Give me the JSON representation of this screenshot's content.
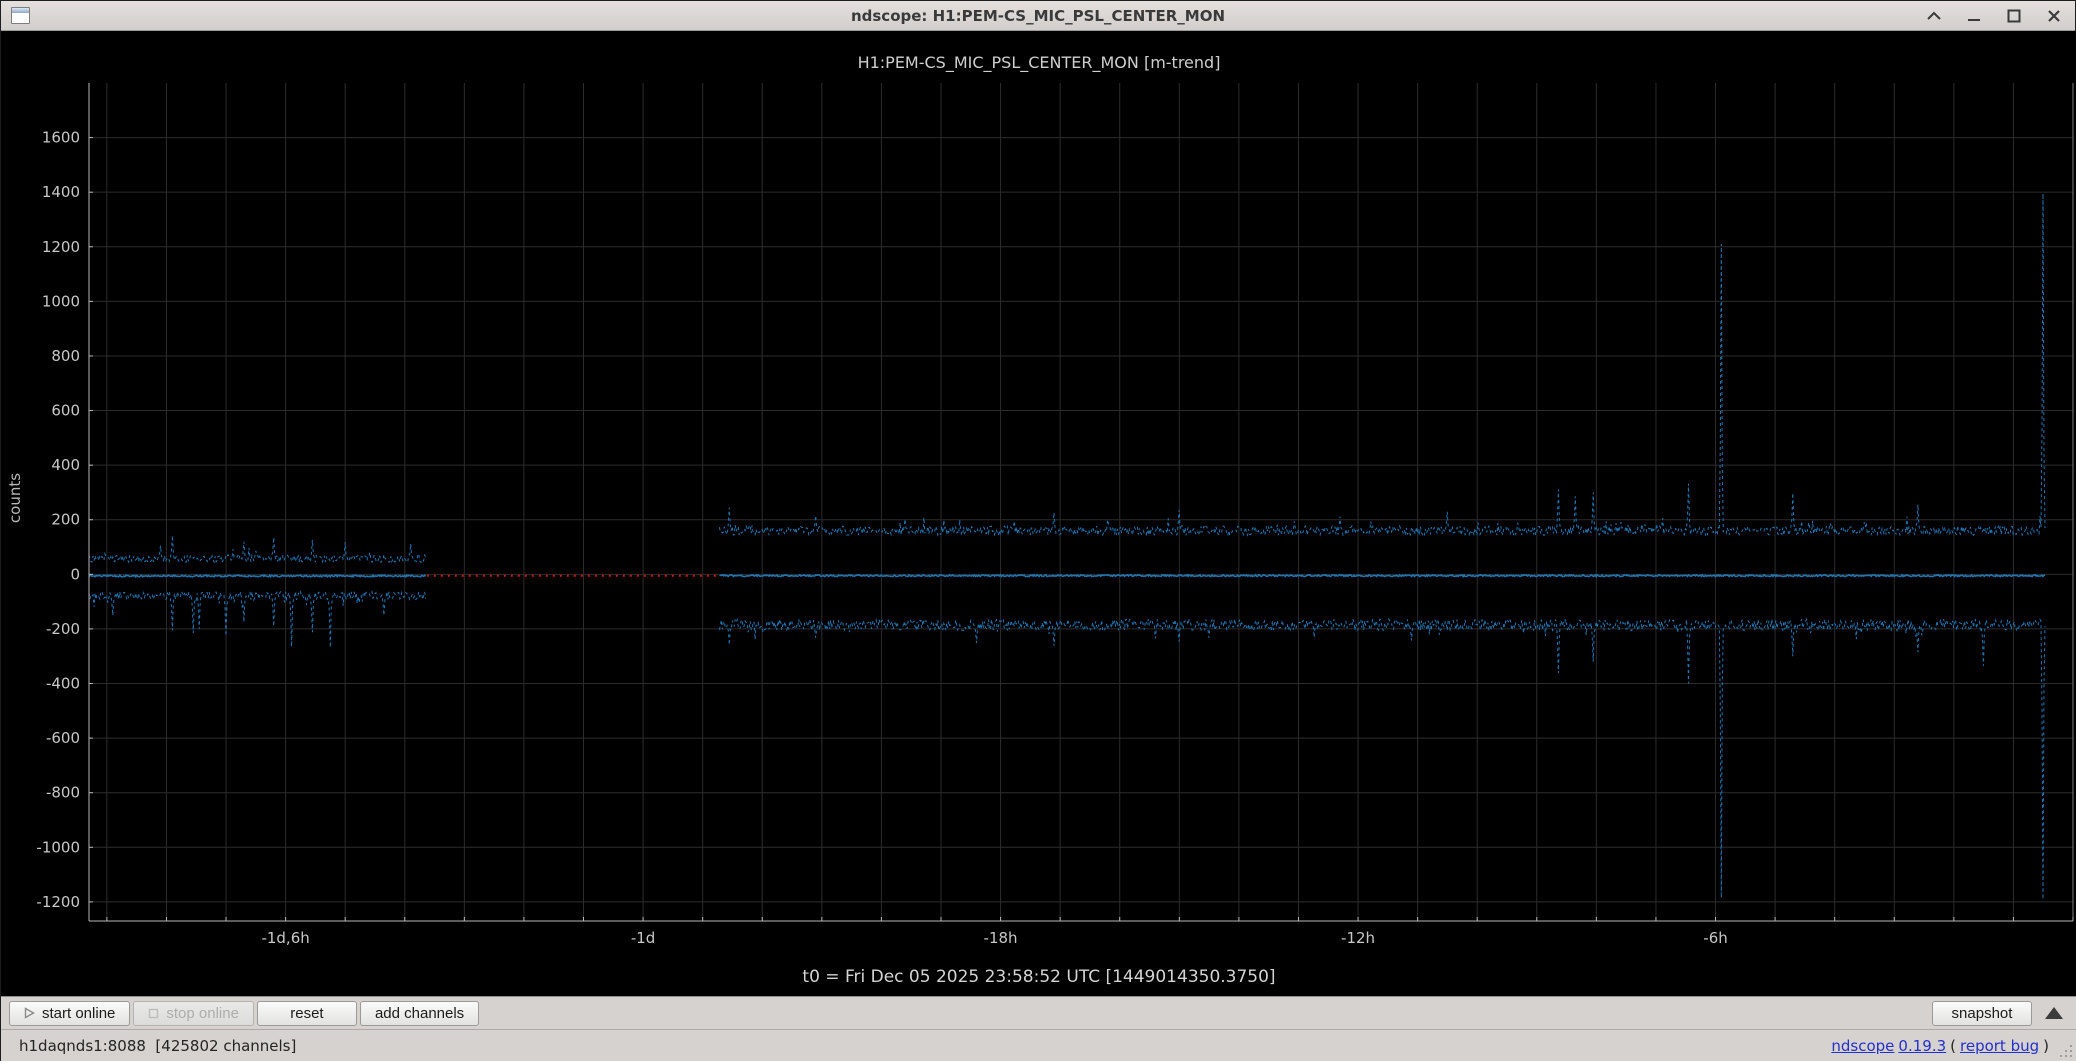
{
  "window": {
    "title": "ndscope: H1:PEM-CS_MIC_PSL_CENTER_MON"
  },
  "titlebar": {
    "icons": [
      "window-icon",
      "shade-chevron-up-icon",
      "minimize-icon",
      "maximize-icon",
      "close-x-icon"
    ]
  },
  "toolbar": {
    "start_label": "start online",
    "stop_label": "stop online",
    "reset_label": "reset",
    "add_channels_label": "add channels",
    "snapshot_label": "snapshot",
    "icons": [
      "play-triangle-icon",
      "stop-square-icon",
      "collapse-triangle-up-icon"
    ]
  },
  "statusbar": {
    "server_info": "h1daqnds1:8088  [425802 channels]",
    "app_link": "ndscope",
    "version_link": "0.19.3",
    "paren_open": "(",
    "bug_link": "report bug",
    "paren_close": ")"
  },
  "chart_data": {
    "type": "line",
    "title": "H1:PEM-CS_MIC_PSL_CENTER_MON [m-trend]",
    "ylabel": "counts",
    "t0_label": "t0 = Fri Dec 05 2025 23:58:52 UTC [1449014350.3750]",
    "ylim": [
      -1270,
      1800
    ],
    "xlim_hours": [
      -33.3,
      0
    ],
    "yticks": [
      1600,
      1400,
      1200,
      1000,
      800,
      600,
      400,
      200,
      0,
      -200,
      -400,
      -600,
      -800,
      -1000,
      -1200
    ],
    "xticks": [
      {
        "label": "-1d,6h",
        "t": -30
      },
      {
        "label": "-1d",
        "t": -24
      },
      {
        "label": "-18h",
        "t": -18
      },
      {
        "label": "-12h",
        "t": -12
      },
      {
        "label": "-6h",
        "t": -6
      }
    ],
    "grid": true,
    "grid_step_hours": 1,
    "sample_minutes": 1,
    "legend": "none",
    "colors": {
      "trace": "#1f77b4",
      "gap": "#cc1a1a",
      "axis": "#b8b8b8",
      "frame": "#7e7e7e",
      "grid": "#2c2c2c",
      "text": "#c8c8c8"
    },
    "gap": {
      "t_start": -27.63,
      "t_end": -22.72,
      "value": -5
    },
    "segments": [
      {
        "name": "early",
        "t_start": -33.3,
        "t_end": -27.63,
        "max": {
          "base": 57,
          "noise": 13
        },
        "min": {
          "base": -78,
          "noise": 15
        },
        "mean": {
          "base": -6,
          "noise": 3
        },
        "events": [
          {
            "t": -32.9,
            "min": -150
          },
          {
            "t": -32.1,
            "max": 105
          },
          {
            "t": -31.9,
            "max": 142,
            "min": -205
          },
          {
            "t": -31.55,
            "min": -215
          },
          {
            "t": -31.45,
            "min": -200
          },
          {
            "t": -31.0,
            "min": -225
          },
          {
            "t": -30.7,
            "max": 120,
            "min": -175
          },
          {
            "t": -30.2,
            "max": 135,
            "min": -190
          },
          {
            "t": -29.9,
            "min": -265
          },
          {
            "t": -29.55,
            "max": 126,
            "min": -212
          },
          {
            "t": -29.25,
            "min": -268
          },
          {
            "t": -29.0,
            "max": 118
          },
          {
            "t": -28.35,
            "min": -150
          },
          {
            "t": -27.9,
            "max": 112
          }
        ]
      },
      {
        "name": "recent",
        "t_start": -22.72,
        "t_end": -0.45,
        "max": {
          "base": 160,
          "noise": 17
        },
        "min": {
          "base": -185,
          "noise": 21
        },
        "mean": {
          "base": -5,
          "noise": 3
        },
        "events": [
          {
            "t": -22.55,
            "max": 245,
            "min": -258
          },
          {
            "t": -21.1,
            "max": 215,
            "min": -232
          },
          {
            "t": -19.6,
            "max": 202
          },
          {
            "t": -18.4,
            "min": -252
          },
          {
            "t": -17.1,
            "max": 226,
            "min": -262
          },
          {
            "t": -15.0,
            "max": 236,
            "min": -246
          },
          {
            "t": -14.5,
            "min": -232
          },
          {
            "t": -12.3,
            "max": 212
          },
          {
            "t": -11.1,
            "min": -242
          },
          {
            "t": -10.5,
            "max": 230
          },
          {
            "t": -8.63,
            "max": 310,
            "min": -362
          },
          {
            "t": -8.35,
            "max": 286
          },
          {
            "t": -8.05,
            "max": 300,
            "min": -320
          },
          {
            "t": -6.45,
            "max": 332,
            "min": -400
          },
          {
            "t": -5.9,
            "max": 1210,
            "min": -1185
          },
          {
            "t": -4.7,
            "max": 298,
            "min": -300
          },
          {
            "t": -2.6,
            "max": 255,
            "min": -285
          },
          {
            "t": -1.5,
            "min": -335
          },
          {
            "t": -0.5,
            "max": 1395,
            "min": -1190
          }
        ]
      }
    ]
  }
}
